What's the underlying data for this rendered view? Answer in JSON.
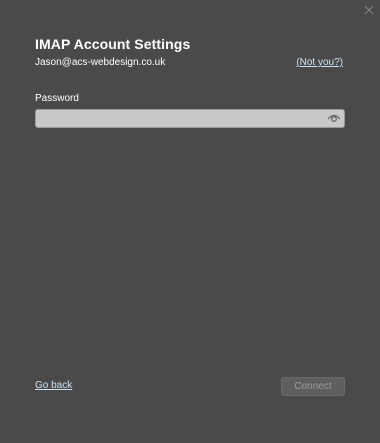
{
  "dialog": {
    "title": "IMAP Account Settings",
    "email": "Jason@acs-webdesign.co.uk",
    "not_you_link": "(Not you?)"
  },
  "password": {
    "label": "Password",
    "value": "",
    "placeholder": "",
    "reveal_icon": "eye-icon"
  },
  "footer": {
    "go_back_link": "Go back",
    "connect_label": "Connect",
    "connect_enabled": false
  },
  "window": {
    "close_icon": "close-icon"
  },
  "colors": {
    "background": "#4a4a4a",
    "link": "#cde3f4",
    "field_bg": "#c8c8c8",
    "button_disabled_bg": "#5f5f5f",
    "button_disabled_text": "#9a9a9a"
  }
}
